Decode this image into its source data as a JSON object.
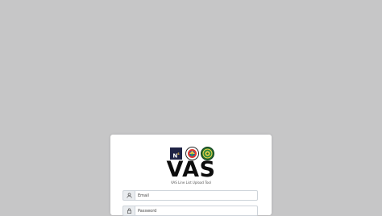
{
  "brand": {
    "logo_ns_text": "N",
    "logo_ns_sup": "s",
    "title": "VAS",
    "subtitle": "VAS Line List Upload Tool"
  },
  "form": {
    "email_placeholder": "Email",
    "email_value": "",
    "password_placeholder": "Password",
    "password_value": ""
  },
  "icons": {
    "email": "user-icon",
    "password": "lock-icon"
  },
  "colors": {
    "page_background": "#c6c6c7",
    "card_background": "#ffffff",
    "logo_ns_background": "#1f2345"
  }
}
